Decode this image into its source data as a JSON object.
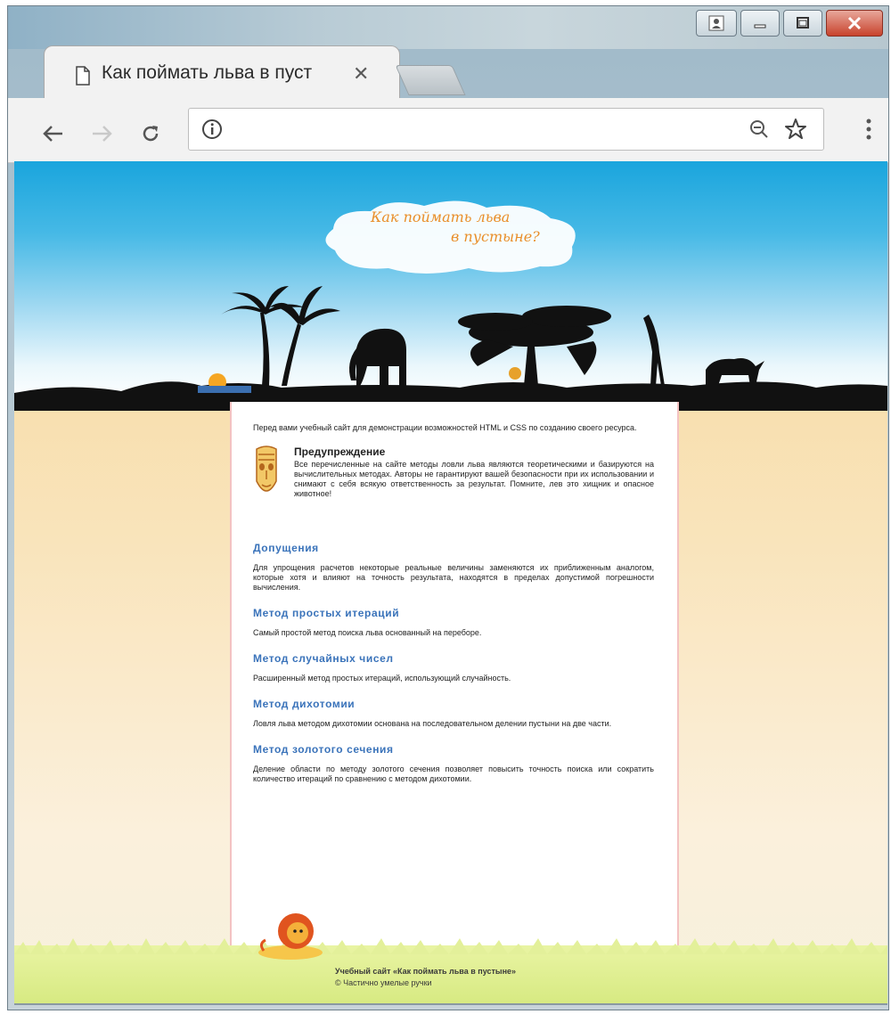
{
  "browser": {
    "tab_title": "Как поймать льва в пуст",
    "tab_close": "✕",
    "address_value": "",
    "address_placeholder": ""
  },
  "site": {
    "logo_line1": "Как поймать льва",
    "logo_line2": "в пустыне?",
    "intro": "Перед вами учебный сайт для демонстрации возможностей HTML и CSS по созданию своего ресурса.",
    "warning": {
      "title": "Предупреждение",
      "body": "Все перечисленные на сайте методы ловли льва являются теоретическими и базируются на вычислительных методах. Авторы не гарантируют вашей безопасности при их использовании и снимают с себя всякую ответственность за результат. Помните, лев это хищник и опасное животное!"
    },
    "sections": [
      {
        "heading": "Допущения",
        "text": "Для упрощения расчетов некоторые реальные величины заменяются их приближенным аналогом, которые хотя и влияют на точность результата, находятся в пределах допустимой погрешности вычисления."
      },
      {
        "heading": "Метод простых итераций",
        "text": "Самый простой метод поиска льва основанный на переборе."
      },
      {
        "heading": "Метод случайных чисел",
        "text": "Расширенный метод простых итераций, использующий случайность."
      },
      {
        "heading": "Метод дихотомии",
        "text": "Ловля льва методом дихотомии основана на последовательном делении пустыни на две части."
      },
      {
        "heading": "Метод золотого сечения",
        "text": "Деление области по методу золотого сечения позволяет повысить точность поиска или сократить количество итераций по сравнению с методом дихотомии."
      }
    ],
    "footer_line1": "Учебный сайт «Как поймать льва в пустыне»",
    "footer_line2": "© Частично умелые ручки"
  },
  "colors": {
    "sky": "#1aa5dd",
    "desert": "#f7d79b",
    "heading": "#3a73ba",
    "logo": "#e98f2a",
    "grass": "#d7ea82"
  },
  "icons": [
    "document-icon",
    "close-icon",
    "back-arrow-icon",
    "forward-arrow-icon",
    "reload-icon",
    "info-icon",
    "zoom-out-icon",
    "star-icon",
    "menu-icon",
    "user-icon",
    "minimize-icon",
    "maximize-icon",
    "window-close-icon",
    "tribal-mask-icon",
    "lion-icon"
  ]
}
